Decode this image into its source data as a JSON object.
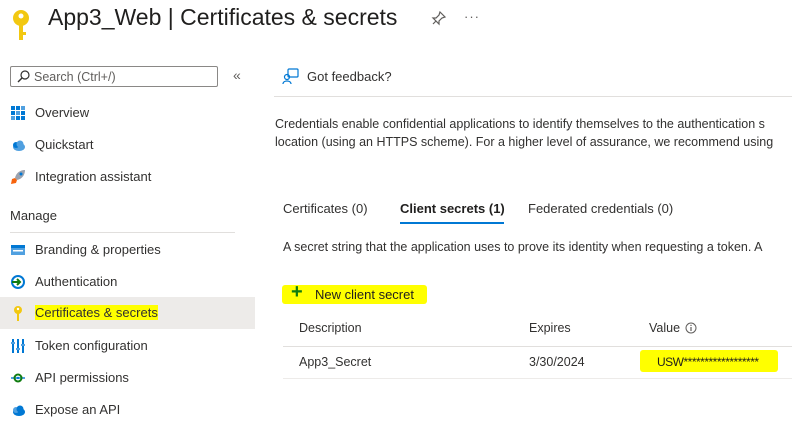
{
  "header": {
    "title": "App3_Web | Certificates & secrets",
    "icons": [
      "key-icon",
      "pin-icon",
      "more-icon"
    ],
    "more_label": "···"
  },
  "sidebar": {
    "search_placeholder": "Search (Ctrl+/)",
    "collapse_label": "«",
    "items": [
      {
        "label": "Overview",
        "icon": "grid-icon"
      },
      {
        "label": "Quickstart",
        "icon": "cloud-icon"
      },
      {
        "label": "Integration assistant",
        "icon": "rocket-icon"
      }
    ],
    "manage_header": "Manage",
    "manage_items": [
      {
        "label": "Branding & properties",
        "icon": "branding-icon"
      },
      {
        "label": "Authentication",
        "icon": "authentication-icon"
      },
      {
        "label": "Certificates & secrets",
        "icon": "key-icon",
        "active": true
      },
      {
        "label": "Token configuration",
        "icon": "token-icon"
      },
      {
        "label": "API permissions",
        "icon": "api-permissions-icon"
      },
      {
        "label": "Expose an API",
        "icon": "cloud-api-icon"
      }
    ]
  },
  "main": {
    "feedback_label": "Got feedback?",
    "description_line1": "Credentials enable confidential applications to identify themselves to the authentication s",
    "description_line2": "location (using an HTTPS scheme). For a higher level of assurance, we recommend using",
    "tabs": [
      {
        "label": "Certificates (0)"
      },
      {
        "label": "Client secrets (1)",
        "active": true
      },
      {
        "label": "Federated credentials (0)"
      }
    ],
    "tab_description": "A secret string that the application uses to prove its identity when requesting a token. A",
    "new_secret_label": "New client secret",
    "table": {
      "headers": [
        "Description",
        "Expires",
        "Value"
      ],
      "rows": [
        {
          "description": "App3_Secret",
          "expires": "3/30/2024",
          "value": "USW******************"
        }
      ]
    }
  },
  "colors": {
    "accent": "#0078d4",
    "highlight": "#ffff00",
    "key_gold": "#f2c811",
    "active_bg": "#edebe9"
  }
}
